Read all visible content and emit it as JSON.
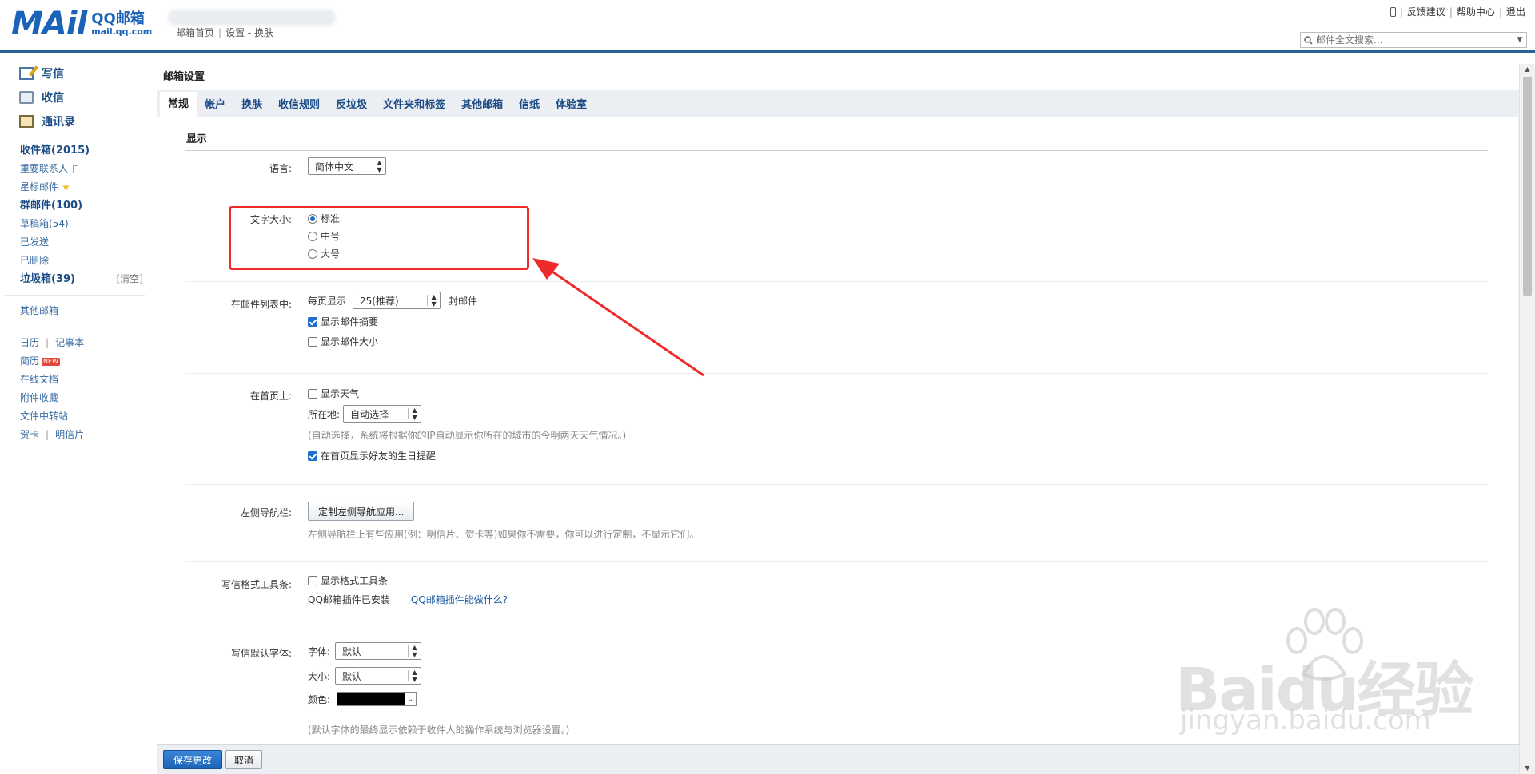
{
  "header": {
    "logo_mail": "MAil",
    "logo_name": "QQ邮箱",
    "logo_domain": "mail.qq.com",
    "nav": [
      "邮箱首页",
      "设置",
      "换肤"
    ],
    "top_links": [
      "反馈建议",
      "帮助中心",
      "退出"
    ],
    "search_placeholder": "邮件全文搜索..."
  },
  "sidebar": {
    "main": [
      {
        "label": "写信",
        "icon": "write-icon"
      },
      {
        "label": "收信",
        "icon": "inbox-icon"
      },
      {
        "label": "通讯录",
        "icon": "contacts-icon"
      }
    ],
    "folders": [
      {
        "label": "收件箱(2015)",
        "bold": true
      },
      {
        "label": "重要联系人",
        "icon": "bookmark-icon"
      },
      {
        "label": "星标邮件",
        "icon": "star-icon"
      },
      {
        "label": "群邮件(100)",
        "bold": true
      },
      {
        "label": "草稿箱(54)"
      },
      {
        "label": "已发送"
      },
      {
        "label": "已删除"
      },
      {
        "label": "垃圾箱(39)",
        "bold": true,
        "extra": "[清空]"
      }
    ],
    "other_mailbox": "其他邮箱",
    "apps": {
      "calendar": "日历",
      "notes": "记事本",
      "resume": "简历",
      "new_badge": "NEW",
      "online_docs": "在线文档",
      "attachments": "附件收藏",
      "file_transfer": "文件中转站",
      "greeting_card": "贺卡",
      "postcard": "明信片"
    }
  },
  "main": {
    "page_title": "邮箱设置",
    "tabs": [
      "常规",
      "帐户",
      "换肤",
      "收信规则",
      "反垃圾",
      "文件夹和标签",
      "其他邮箱",
      "信纸",
      "体验室"
    ],
    "active_tab": "常规",
    "section_title": "显示",
    "language": {
      "label": "语言:",
      "value": "简体中文"
    },
    "font_size": {
      "label": "文字大小:",
      "options": [
        "标准",
        "中号",
        "大号"
      ],
      "selected": "标准"
    },
    "mail_list": {
      "label": "在邮件列表中:",
      "per_page_prefix": "每页显示",
      "per_page_value": "25(推荐)",
      "per_page_suffix": "封邮件",
      "show_summary": "显示邮件摘要",
      "show_summary_checked": true,
      "show_size": "显示邮件大小",
      "show_size_checked": false
    },
    "home_page": {
      "label": "在首页上:",
      "show_weather": "显示天气",
      "show_weather_checked": false,
      "location_label": "所在地:",
      "location_value": "自动选择",
      "location_hint": "(自动选择，系统将根据你的IP自动显示你所在的城市的今明两天天气情况。)",
      "birthday": "在首页显示好友的生日提醒",
      "birthday_checked": true
    },
    "left_nav": {
      "label": "左侧导航栏:",
      "button": "定制左侧导航应用...",
      "hint": "左侧导航栏上有些应用(例：明信片、贺卡等)如果你不需要，你可以进行定制，不显示它们。"
    },
    "toolbar": {
      "label": "写信格式工具条:",
      "show_toolbar": "显示格式工具条",
      "show_toolbar_checked": false,
      "plugin_installed": "QQ邮箱插件已安装",
      "plugin_link": "QQ邮箱插件能做什么?"
    },
    "default_font": {
      "label": "写信默认字体:",
      "font_label": "字体:",
      "font_value": "默认",
      "size_label": "大小:",
      "size_value": "默认",
      "color_label": "颜色:",
      "color_value": "#000000",
      "hint": "(默认字体的最终显示依赖于收件人的操作系统与浏览器设置。)"
    }
  },
  "footer": {
    "save": "保存更改",
    "cancel": "取消"
  },
  "annotation": {
    "highlight_color": "#ef2a2a"
  },
  "watermark": {
    "brand": "Baidu经验",
    "url": "jingyan.baidu.com"
  },
  "colors": {
    "accent": "#1b4c86",
    "primary_button": "#1b63b5",
    "link": "#1b5aa5"
  }
}
